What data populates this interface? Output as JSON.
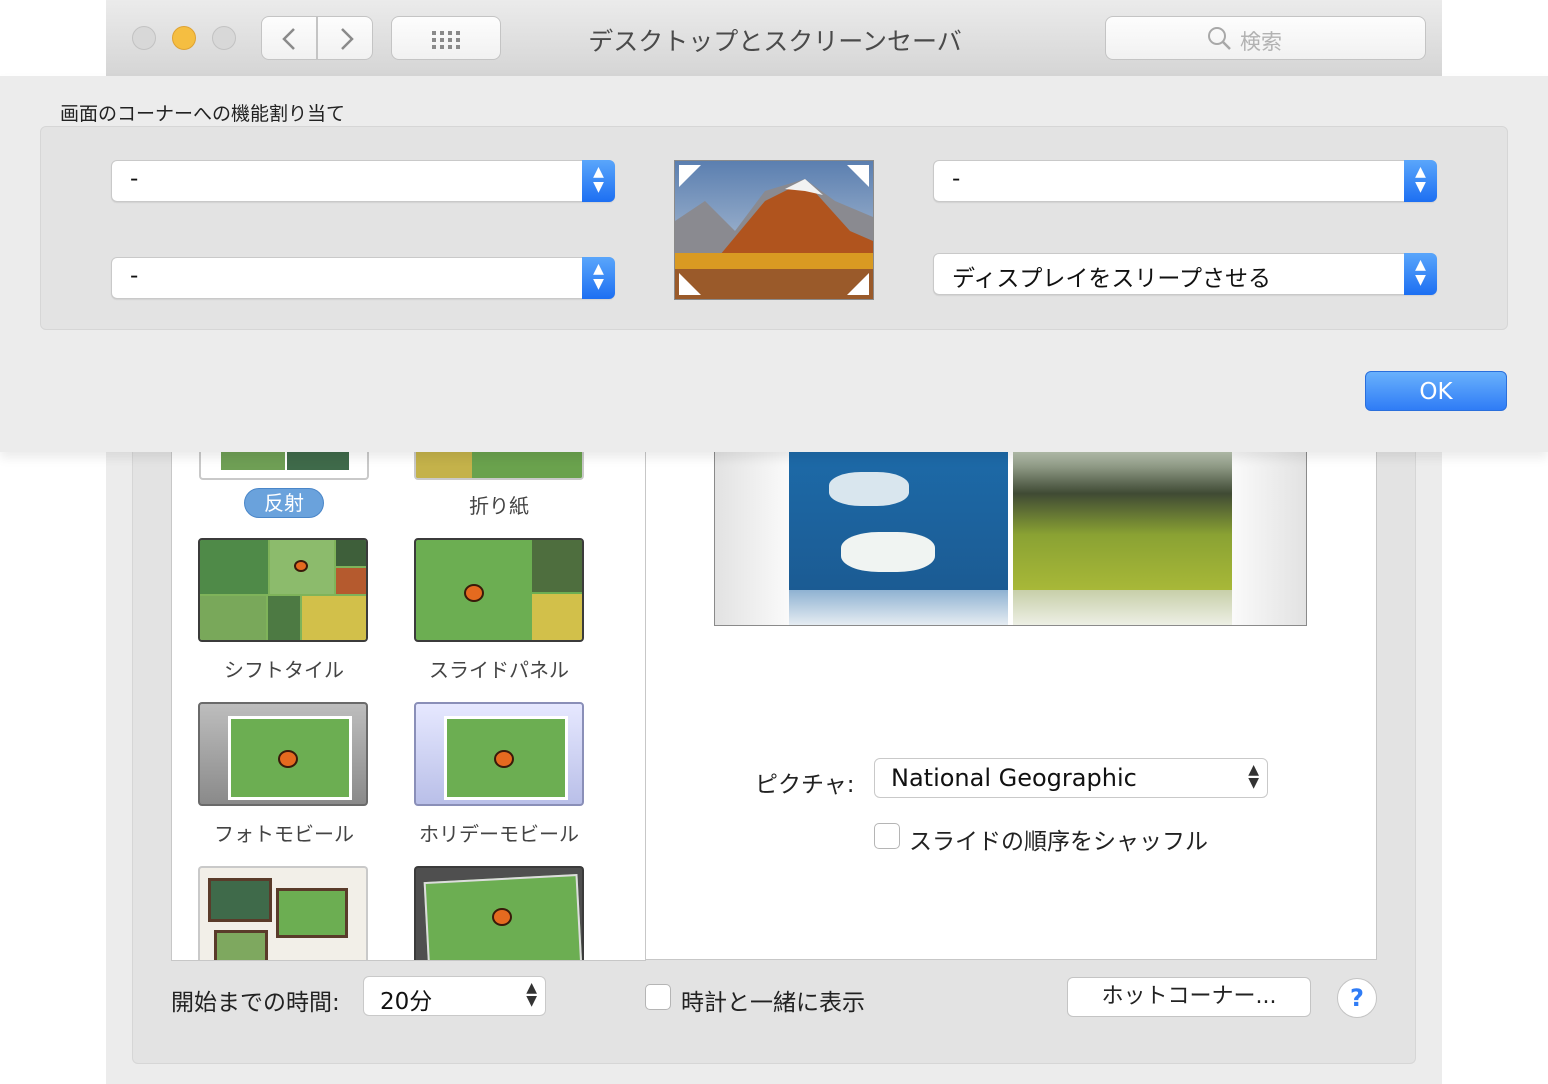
{
  "window": {
    "title": "デスクトップとスクリーンセーバ",
    "search_placeholder": "検索",
    "nav_back_icon": "chevron-left-icon",
    "nav_forward_icon": "chevron-right-icon",
    "grid_icon": "grid-icon"
  },
  "hot_corners_sheet": {
    "heading": "画面のコーナーへの機能割り当て",
    "top_left": "-",
    "bottom_left": "-",
    "top_right": "-",
    "bottom_right": "ディスプレイをスリープさせる",
    "ok_label": "OK",
    "accent_color": "#2f7cf6"
  },
  "screensavers": {
    "items": [
      {
        "label": "反射",
        "selected": true
      },
      {
        "label": "折り紙",
        "selected": false
      },
      {
        "label": "シフトタイル",
        "selected": false
      },
      {
        "label": "スライドパネル",
        "selected": false
      },
      {
        "label": "フォトモビール",
        "selected": false
      },
      {
        "label": "ホリデーモビール",
        "selected": false
      }
    ]
  },
  "preview": {
    "picture_label": "ピクチャ:",
    "picture_source": "National Geographic",
    "shuffle_label": "スライドの順序をシャッフル",
    "shuffle_checked": false
  },
  "footer": {
    "start_after_label": "開始までの時間:",
    "start_after_value": "20分",
    "show_clock_label": "時計と一緒に表示",
    "show_clock_checked": false,
    "hot_corners_button": "ホットコーナー...",
    "help_label": "?"
  }
}
